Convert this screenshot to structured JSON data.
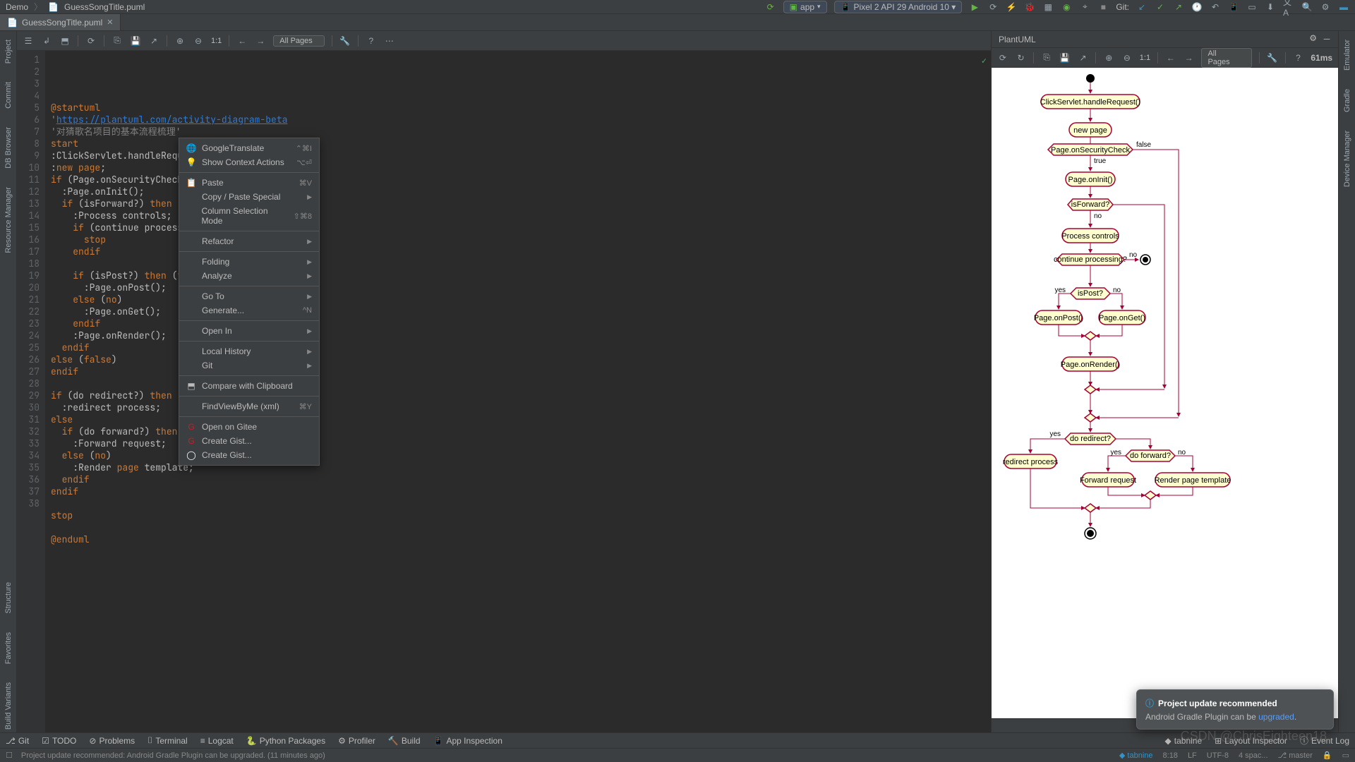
{
  "titlebar": {
    "project": "Demo",
    "file_icon": "📄",
    "filename": "GuessSongTitle.puml"
  },
  "run": {
    "config": "app",
    "device": "Pixel 2 API 29 Android 10 ▾"
  },
  "git_label": "Git:",
  "tab": {
    "label": "GuessSongTitle.puml"
  },
  "rails": {
    "left": [
      "Project",
      "Commit",
      "DB Browser",
      "Resource Manager",
      "Structure",
      "Favorites",
      "Build Variants"
    ],
    "right": [
      "Emulator",
      "Gradle",
      "Device Manager"
    ]
  },
  "editor_toolbar": {
    "pages": "All Pages",
    "zoom": "1:1"
  },
  "preview": {
    "title": "PlantUML",
    "pages": "All Pages",
    "zoom": "1:1",
    "timing": "61ms"
  },
  "code_lines": [
    "@startuml",
    "'https://plantuml.com/activity-diagram-beta",
    "'对猜歌名项目的基本流程梳理'",
    "start",
    ":ClickServlet.handleRequest();",
    ":new page;",
    "if (Page.onSecurityCheck) then (true)",
    "  :Page.onInit();",
    "  if (isForward?) then (no)",
    "    :Process controls;",
    "    if (continue processing?) t",
    "      stop",
    "    endif",
    "",
    "    if (isPost?) then (yes)",
    "      :Page.onPost();",
    "    else (no)",
    "      :Page.onGet();",
    "    endif",
    "    :Page.onRender();",
    "  endif",
    "else (false)",
    "endif",
    "",
    "if (do redirect?) then (yes)",
    "  :redirect process;",
    "else",
    "  if (do forward?) then (yes)",
    "    :Forward request;",
    "  else (no)",
    "    :Render page template;",
    "  endif",
    "endif",
    "",
    "stop",
    "",
    "@enduml",
    ""
  ],
  "menu": [
    {
      "label": "GoogleTranslate",
      "sc": "⌃⌘I",
      "icon": "🌐"
    },
    {
      "label": "Show Context Actions",
      "sc": "⌥⏎",
      "icon": "💡"
    },
    {
      "sep": true
    },
    {
      "label": "Paste",
      "sc": "⌘V",
      "icon": "📋"
    },
    {
      "label": "Copy / Paste Special",
      "arrow": true
    },
    {
      "label": "Column Selection Mode",
      "sc": "⇧⌘8"
    },
    {
      "sep": true
    },
    {
      "label": "Refactor",
      "arrow": true
    },
    {
      "sep": true
    },
    {
      "label": "Folding",
      "arrow": true
    },
    {
      "label": "Analyze",
      "arrow": true
    },
    {
      "sep": true
    },
    {
      "label": "Go To",
      "arrow": true
    },
    {
      "label": "Generate...",
      "sc": "^N"
    },
    {
      "sep": true
    },
    {
      "label": "Open In",
      "arrow": true
    },
    {
      "sep": true
    },
    {
      "label": "Local History",
      "arrow": true
    },
    {
      "label": "Git",
      "arrow": true
    },
    {
      "sep": true
    },
    {
      "label": "Compare with Clipboard",
      "icon": "⬒"
    },
    {
      "sep": true
    },
    {
      "label": "FindViewByMe (xml)",
      "sc": "⌘Y"
    },
    {
      "sep": true
    },
    {
      "label": "Open on Gitee",
      "icon": "G",
      "iconColor": "#c71d23"
    },
    {
      "label": "Create Gist...",
      "icon": "G",
      "iconColor": "#c71d23"
    },
    {
      "label": "Create Gist...",
      "icon": "◯",
      "iconColor": "#fff"
    }
  ],
  "diagram": {
    "nodes": {
      "click": "ClickServlet.handleRequest()",
      "newpage": "new page",
      "sec": "Page.onSecurityCheck",
      "init": "Page.onInit()",
      "fwd": "isForward?",
      "proc": "Process controls",
      "cont": "continue processing?",
      "post": "isPost?",
      "onpost": "Page.onPost()",
      "onget": "Page.onGet()",
      "render": "Page.onRender()",
      "redir": "do redirect?",
      "redirp": "redirect process",
      "dofwd": "do forward?",
      "fwdreq": "Forward request",
      "rendtpl": "Render page template"
    },
    "labels": {
      "true": "true",
      "false": "false",
      "yes": "yes",
      "no": "no"
    }
  },
  "notification": {
    "title": "Project update recommended",
    "body_pre": "Android Gradle Plugin can be ",
    "link": "upgraded"
  },
  "tool_windows": {
    "left": [
      {
        "icon": "⎇",
        "label": "Git"
      },
      {
        "icon": "☑",
        "label": "TODO"
      },
      {
        "icon": "⊘",
        "label": "Problems"
      },
      {
        "icon": "⌷",
        "label": "Terminal"
      },
      {
        "icon": "≡",
        "label": "Logcat"
      },
      {
        "icon": "🐍",
        "label": "Python Packages"
      },
      {
        "icon": "⚙",
        "label": "Profiler"
      },
      {
        "icon": "🔨",
        "label": "Build"
      },
      {
        "icon": "📱",
        "label": "App Inspection"
      }
    ],
    "right": [
      {
        "icon": "◆",
        "label": "tabnine"
      },
      {
        "icon": "⊞",
        "label": "Layout Inspector"
      },
      {
        "icon": "ⓘ",
        "label": "Event Log"
      }
    ]
  },
  "status": {
    "msg": "Project update recommended: Android Gradle Plugin can be upgraded. (11 minutes ago)",
    "pos": "8:18",
    "le": "LF",
    "enc": "UTF-8",
    "indent": "4 spac...",
    "branch": "master",
    "tabnine": "tabnine"
  },
  "watermark": "CSDN @ChrisEighteen18"
}
